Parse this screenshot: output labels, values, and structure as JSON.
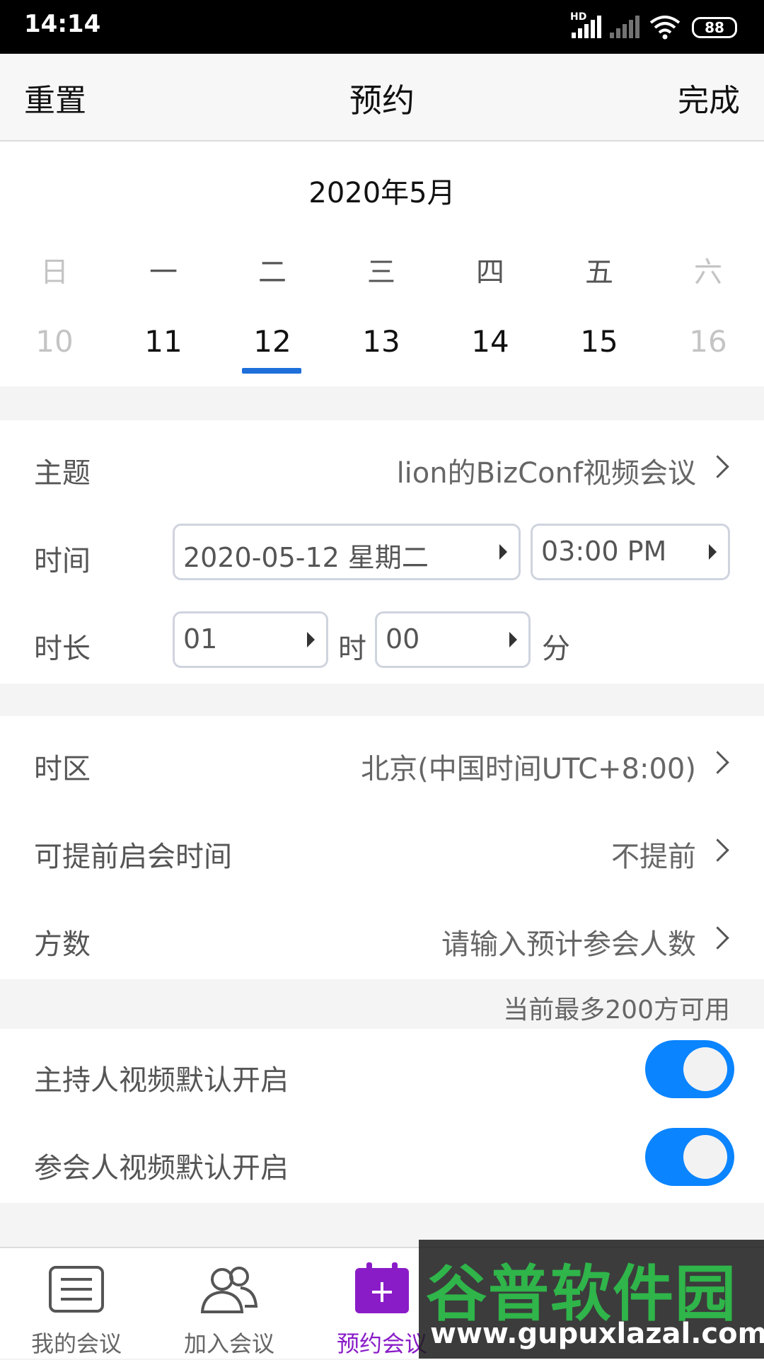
{
  "status_bar": {
    "time": "14:14",
    "hd_label": "HD",
    "battery": "88"
  },
  "nav": {
    "reset_label": "重置",
    "title": "预约",
    "done_label": "完成"
  },
  "calendar": {
    "month_label": "2020年5月",
    "weekdays": [
      "日",
      "一",
      "二",
      "三",
      "四",
      "五",
      "六"
    ],
    "days": [
      "10",
      "11",
      "12",
      "13",
      "14",
      "15",
      "16"
    ],
    "selected_day": "12",
    "accent_color": "#1e6fd9"
  },
  "form": {
    "topic_label": "主题",
    "topic_value": "lion的BizConf视频会议",
    "time_label": "时间",
    "date_value": "2020-05-12 星期二",
    "time_value": "03:00 PM",
    "duration_label": "时长",
    "hours_value": "01",
    "hours_unit": "时",
    "minutes_value": "00",
    "minutes_unit": "分",
    "timezone_label": "时区",
    "timezone_value": "北京(中国时间UTC+8:00)",
    "early_label": "可提前启会时间",
    "early_value": "不提前",
    "participants_label": "方数",
    "participants_placeholder": "请输入预计参会人数",
    "capacity_note": "当前最多200方可用",
    "host_video_label": "主持人视频默认开启",
    "host_video_on": true,
    "attendee_video_label": "参会人视频默认开启",
    "attendee_video_on": true,
    "toggle_color": "#0a84ff"
  },
  "tabs": [
    {
      "label": "我的会议",
      "icon": "list-icon"
    },
    {
      "label": "加入会议",
      "icon": "people-icon"
    },
    {
      "label": "预约会议",
      "icon": "calendar-plus-icon",
      "active_color": "#8a1cc8"
    }
  ],
  "watermark": {
    "line1": "谷普软件园",
    "line2": "www.gupuxlazal.com"
  }
}
